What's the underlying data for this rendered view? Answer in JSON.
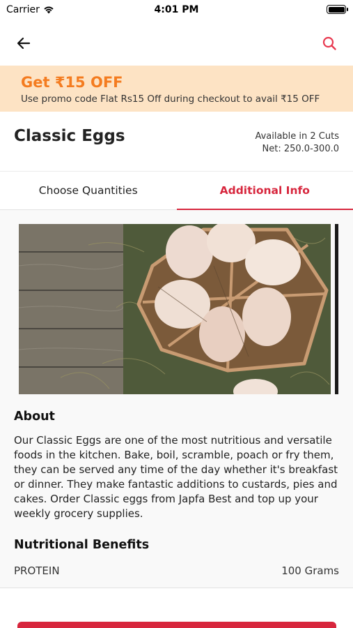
{
  "status_bar": {
    "carrier": "Carrier",
    "time": "4:01 PM"
  },
  "nav": {
    "back_icon": "arrow-left-icon",
    "search_icon": "search-icon"
  },
  "promo": {
    "title": "Get ₹15 OFF",
    "text": "Use promo code Flat Rs15 Off  during checkout to avail ₹15 OFF"
  },
  "product": {
    "title": "Classic Eggs",
    "availability": "Available in 2 Cuts",
    "net": "Net: 250.0-300.0"
  },
  "tabs": [
    {
      "label": "Choose Quantities",
      "active": false
    },
    {
      "label": "Additional Info",
      "active": true
    }
  ],
  "about": {
    "heading": "About",
    "text": "Our Classic Eggs are one of the most nutritious and versatile foods in the kitchen. Bake, boil, scramble, poach or fry them, they can be served any time of the day whether it's breakfast or dinner. They make fantastic additions to custards, pies and cakes. Order Classic eggs from Japfa Best and top up your weekly  grocery supplies."
  },
  "nutrition": {
    "heading": "Nutritional Benefits",
    "items": [
      {
        "name": "PROTEIN",
        "value": "100 Grams"
      }
    ]
  },
  "colors": {
    "accent": "#d7263d",
    "promo_bg": "#fde3c4",
    "promo_title": "#f47c20"
  }
}
